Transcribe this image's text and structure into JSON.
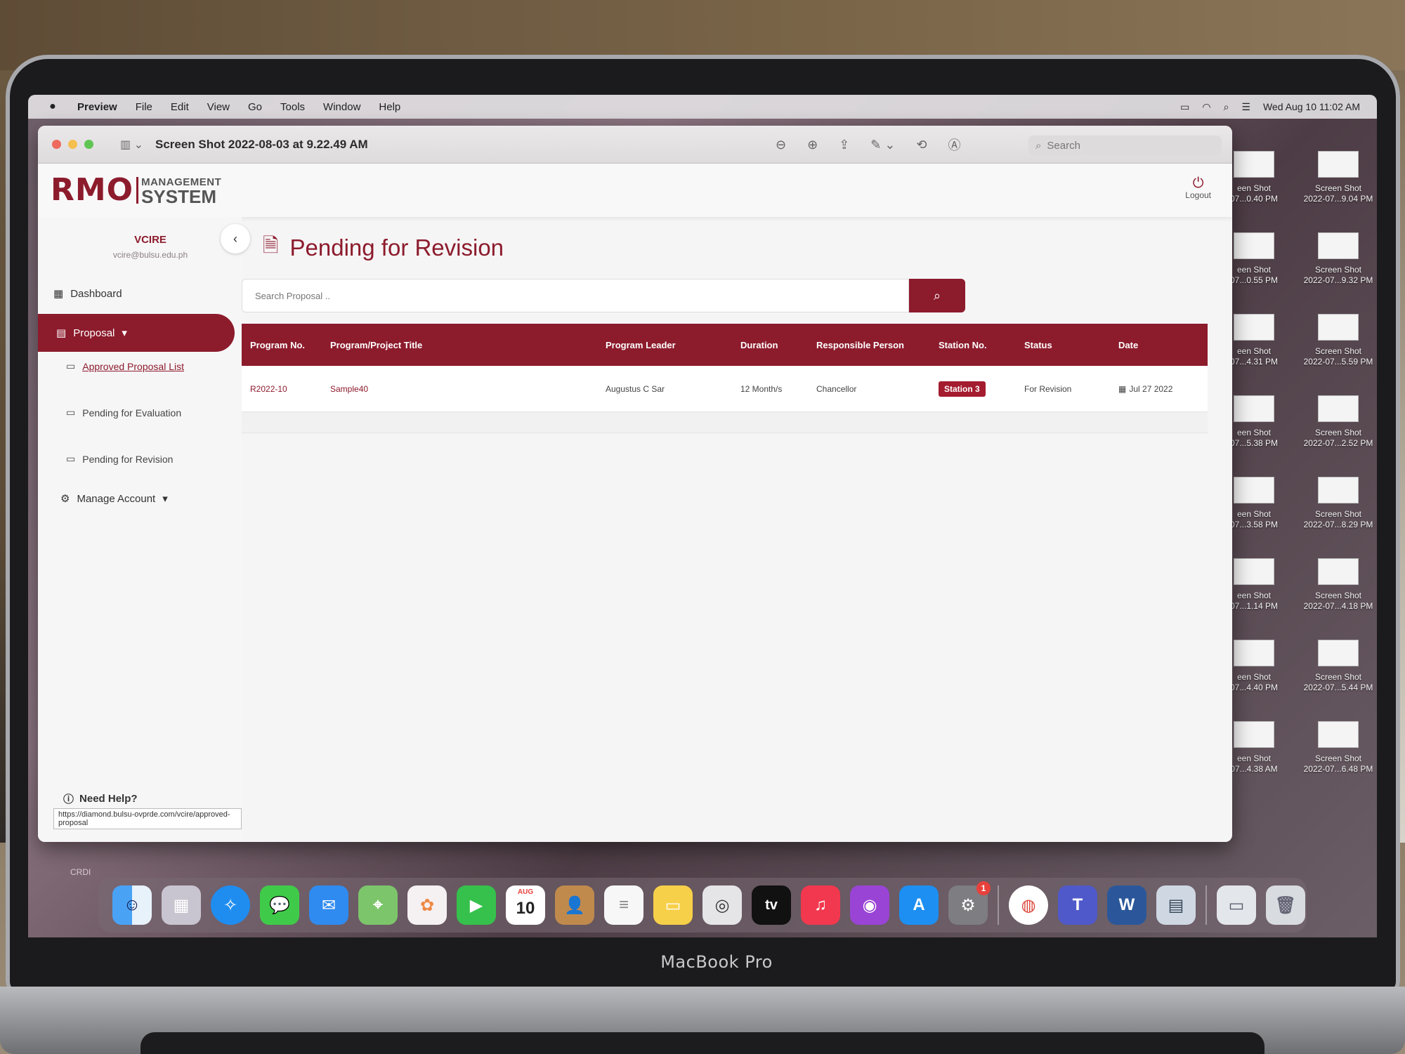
{
  "menubar": {
    "items": [
      "Preview",
      "File",
      "Edit",
      "View",
      "Go",
      "Tools",
      "Window",
      "Help"
    ],
    "clock": "Wed Aug 10  11:02 AM"
  },
  "preview": {
    "title": "Screen Shot 2022-08-03 at 9.22.49 AM",
    "search_placeholder": "Search"
  },
  "app": {
    "logo_main": "RMO",
    "logo_line1": "MANAGEMENT",
    "logo_line2": "SYSTEM",
    "logout_label": "Logout",
    "user": {
      "name": "VCIRE",
      "email": "vcire@bulsu.edu.ph"
    },
    "nav": {
      "dashboard": "Dashboard",
      "proposal": "Proposal",
      "approved": "Approved Proposal List",
      "evaluation": "Pending for Evaluation",
      "revision": "Pending for Revision",
      "manage": "Manage Account"
    },
    "help": "Need Help?",
    "status_url": "https://diamond.bulsu-ovprde.com/vcire/approved-proposal",
    "page_title": "Pending for Revision",
    "search_placeholder": "Search Proposal ..",
    "columns": {
      "program_no": "Program No.",
      "title": "Program/Project Title",
      "leader": "Program Leader",
      "duration": "Duration",
      "responsible": "Responsible Person",
      "station": "Station No.",
      "status": "Status",
      "date": "Date"
    },
    "rows": [
      {
        "program_no": "R2022-10",
        "title": "Sample40",
        "leader": "Augustus C Sar",
        "duration": "12 Month/s",
        "responsible": "Chancellor",
        "station": "Station 3",
        "status": "For Revision",
        "date": "Jul 27 2022"
      }
    ]
  },
  "desktop_icons": [
    {
      "line1": "een Shot",
      "line2": "07...0.40 PM"
    },
    {
      "line1": "Screen Shot",
      "line2": "2022-07...9.04 PM"
    },
    {
      "line1": "een Shot",
      "line2": "07...0.55 PM"
    },
    {
      "line1": "Screen Shot",
      "line2": "2022-07...9.32 PM"
    },
    {
      "line1": "een Shot",
      "line2": "07...4.31 PM"
    },
    {
      "line1": "Screen Shot",
      "line2": "2022-07...5.59 PM"
    },
    {
      "line1": "een Shot",
      "line2": "07...5.38 PM"
    },
    {
      "line1": "Screen Shot",
      "line2": "2022-07...2.52 PM"
    },
    {
      "line1": "een Shot",
      "line2": "07...3.58 PM"
    },
    {
      "line1": "Screen Shot",
      "line2": "2022-07...8.29 PM"
    },
    {
      "line1": "een Shot",
      "line2": "07...1.14 PM"
    },
    {
      "line1": "Screen Shot",
      "line2": "2022-07...4.18 PM"
    },
    {
      "line1": "een Shot",
      "line2": "07...4.40 PM"
    },
    {
      "line1": "Screen Shot",
      "line2": "2022-07...5.44 PM"
    },
    {
      "line1": "een Shot",
      "line2": "07...4.38 AM"
    },
    {
      "line1": "Screen Shot",
      "line2": "2022-07...6.48 PM"
    }
  ],
  "dock": {
    "calendar_month": "AUG",
    "calendar_day": "10",
    "tv_label": "tv",
    "badge": "1"
  },
  "desktop_label": "CRDI",
  "laptop_label": "MacBook Pro"
}
